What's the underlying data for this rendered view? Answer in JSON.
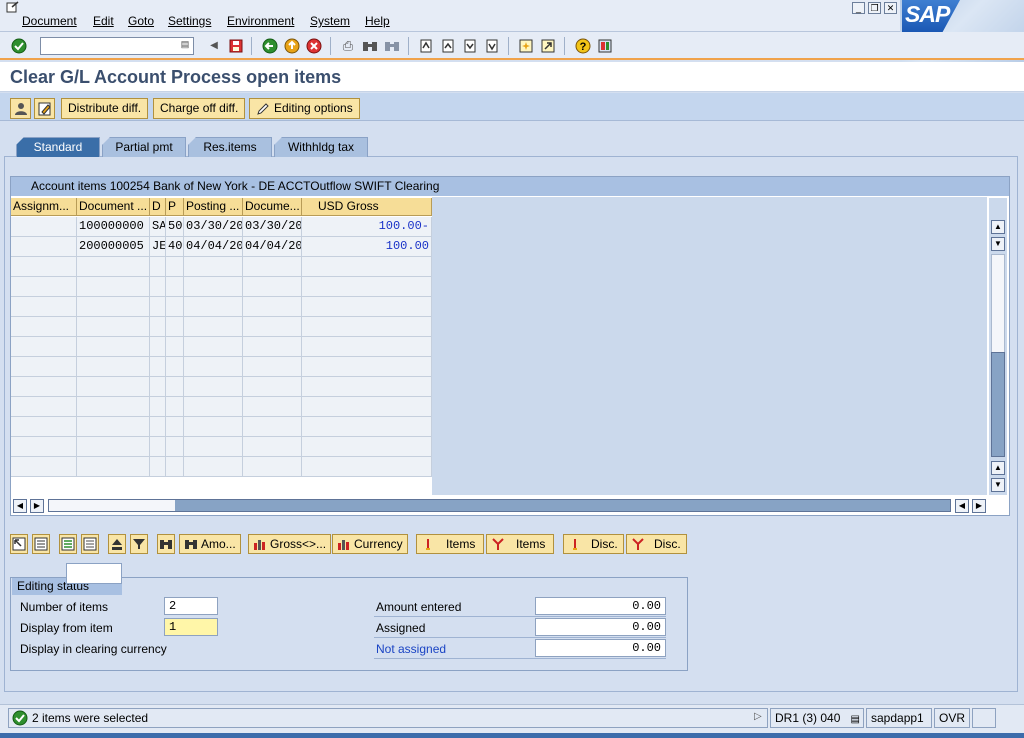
{
  "menu": {
    "items": [
      "Document",
      "Edit",
      "Goto",
      "Settings",
      "Environment",
      "System",
      "Help"
    ]
  },
  "logo": {
    "text": "SAP"
  },
  "toolbar": {
    "command_value": ""
  },
  "page": {
    "title": "Clear G/L Account Process open items"
  },
  "app_toolbar": {
    "distribute_label": "Distribute diff.",
    "charge_off_label": "Charge off diff.",
    "editing_options_label": "Editing options"
  },
  "tabs": [
    {
      "label": "Standard",
      "active": true
    },
    {
      "label": "Partial pmt",
      "active": false
    },
    {
      "label": "Res.items",
      "active": false
    },
    {
      "label": "Withhldg tax",
      "active": false
    }
  ],
  "table": {
    "title": "Account items 100254 Bank of New York - DE ACCTOutflow SWIFT Clearing",
    "columns": [
      "Assignm...",
      "Document ...",
      "D",
      "P",
      "Posting ...",
      "Docume...",
      "USD Gross"
    ],
    "rows": [
      {
        "assignment": "",
        "document": "100000000",
        "type": "SA",
        "pk": "50",
        "posting": "03/30/200",
        "docdate": "03/30/200",
        "gross": "100.00-"
      },
      {
        "assignment": "",
        "document": "200000005",
        "type": "JE",
        "pk": "40",
        "posting": "04/04/200",
        "docdate": "04/04/200",
        "gross": "100.00"
      }
    ]
  },
  "lower_toolbar": {
    "amount_label": "Amo...",
    "gross_label": "Gross<>...",
    "currency_label": "Currency",
    "items_label_1": "Items",
    "items_label_2": "Items",
    "disc_label_1": "Disc.",
    "disc_label_2": "Disc."
  },
  "editing_status": {
    "title": "Editing status",
    "number_of_items_label": "Number of items",
    "number_of_items_value": "2",
    "display_from_label": "Display from item",
    "display_from_value": "1",
    "display_currency_label": "Display in clearing currency",
    "amount_entered_label": "Amount entered",
    "amount_entered_value": "0.00",
    "assigned_label": "Assigned",
    "assigned_value": "0.00",
    "not_assigned_label": "Not assigned",
    "not_assigned_value": "0.00"
  },
  "status_bar": {
    "message": "2 items were selected",
    "system": "DR1 (3) 040",
    "server": "sapdapp1",
    "mode": "OVR"
  },
  "colors": {
    "accent": "#3a6ea8",
    "button": "#f9e5a6",
    "header": "#f6dd97",
    "link": "#1a44c4"
  }
}
